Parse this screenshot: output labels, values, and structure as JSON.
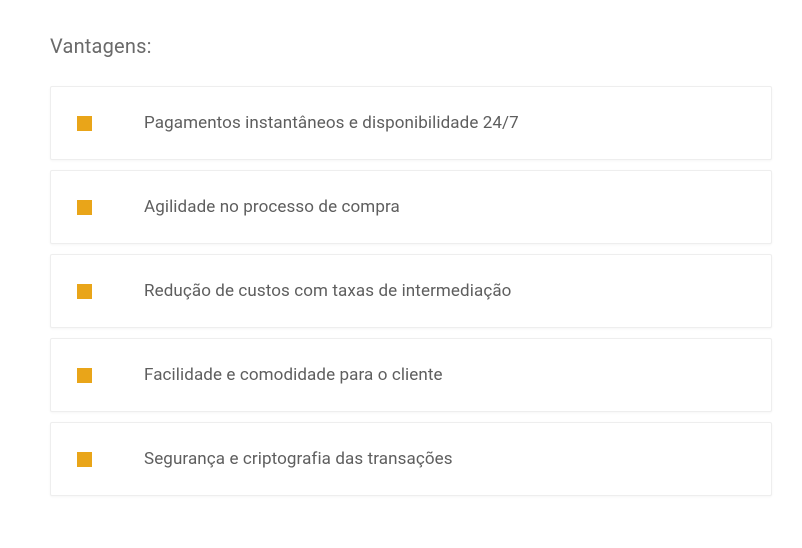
{
  "heading": "Vantagens:",
  "items": [
    {
      "label": "Pagamentos instantâneos e disponibilidade 24/7"
    },
    {
      "label": "Agilidade no processo de compra"
    },
    {
      "label": "Redução de custos com taxas de intermediação"
    },
    {
      "label": "Facilidade e comodidade para o cliente"
    },
    {
      "label": "Segurança e criptografia das transações"
    }
  ],
  "colors": {
    "accent": "#e9a519"
  }
}
